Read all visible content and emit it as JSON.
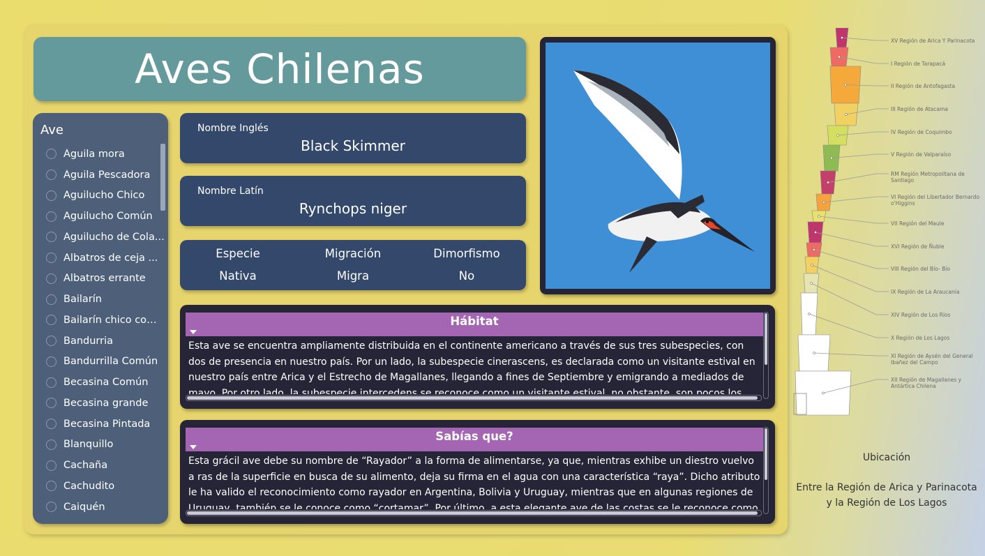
{
  "title": "Aves Chilenas",
  "sidebar": {
    "title": "Ave",
    "items": [
      {
        "label": "Águila mora"
      },
      {
        "label": "Águila Pescadora"
      },
      {
        "label": "Aguilucho Chico"
      },
      {
        "label": "Aguilucho Común"
      },
      {
        "label": "Aguilucho de Cola..."
      },
      {
        "label": "Albatros de ceja ..."
      },
      {
        "label": "Albatros errante"
      },
      {
        "label": "Bailarín"
      },
      {
        "label": "Bailarín chico com..."
      },
      {
        "label": "Bandurria"
      },
      {
        "label": "Bandurrilla Común"
      },
      {
        "label": "Becasina Común"
      },
      {
        "label": "Becasina grande"
      },
      {
        "label": "Becasina Pintada"
      },
      {
        "label": "Blanquillo"
      },
      {
        "label": "Cachaña"
      },
      {
        "label": "Cachudito"
      },
      {
        "label": "Caiquén"
      }
    ]
  },
  "english": {
    "label": "Nombre Inglés",
    "value": "Black Skimmer"
  },
  "latin": {
    "label": "Nombre Latín",
    "value": "Rynchops niger"
  },
  "attributes": [
    {
      "label": "Especie",
      "value": "Nativa"
    },
    {
      "label": "Migración",
      "value": "Migra"
    },
    {
      "label": "Dimorfismo",
      "value": "No"
    }
  ],
  "habitat": {
    "title": "Hábitat",
    "text": "Esta ave se encuentra ampliamente distribuida en el continente americano a través de sus tres subespecies, con dos de presencia en nuestro país. Por un lado, la subespecie cinerascens, es declarada como un visitante estival en nuestro país entre Arica y el Estrecho de Magallanes, llegando a fines de Septiembre y emigrando a mediados de mayo. Por otro lado, la subespecie intercedens se reconoce como un visitante estival, no obstante, son pocos los registros de su presencia en"
  },
  "sabias": {
    "title": "Sabías que?",
    "text": "Esta grácil ave debe su nombre de “Rayador” a la forma de alimentarse, ya que, mientras exhibe un diestro vuelvo a ras de la superficie en busca de su alimento, deja su firma en el agua con una característica “raya”. Dicho atributo le ha valido el reconocimiento como rayador en Argentina, Bolivia y Uruguay, mientras que en algunas regiones de Uruguay, también se le conoce como “cortamar”. Por último, a esta elegante ave de las costas se le reconoce como pico de tijeras,"
  },
  "map": {
    "regions": [
      {
        "label": "XV Región de Arica Y Parinacota",
        "color": "#c0356b"
      },
      {
        "label": "I Región de Tarapacá",
        "color": "#ee6a62"
      },
      {
        "label": "II Región de Antofagasta",
        "color": "#f6a93b"
      },
      {
        "label": "III Región de Atacama",
        "color": "#f2d163"
      },
      {
        "label": "IV Región de Coquimbo",
        "color": "#d5df5f"
      },
      {
        "label": "V Región de Valparaíso",
        "color": "#8fbc52"
      },
      {
        "label": "RM Región Metropolitana de Santiago",
        "color": "#c43f6a"
      },
      {
        "label": "VI Región del Libertador Bernardo o'Higgins",
        "color": "#f6a23d"
      },
      {
        "label": "VII Región del Maule",
        "color": "#e8e16a"
      },
      {
        "label": "XVI Región de Ñuble",
        "color": "#c0356b"
      },
      {
        "label": "VIII Región del Bío- Bío",
        "color": "#ee6a62"
      },
      {
        "label": "IX Región de La Araucanía",
        "color": "#f2d163"
      },
      {
        "label": "XIV Región de Los Ríos",
        "color": "#e6e4b0"
      },
      {
        "label": "X Región de Los Lagos",
        "color": "#ffffff"
      },
      {
        "label": "XI Región de Aysén del General Ibañez del Campo",
        "color": "#ffffff"
      },
      {
        "label": "XII Región de Magallanes y Antártica Chilena",
        "color": "#ffffff"
      }
    ]
  },
  "location": {
    "title": "Ubicación",
    "text": "Entre la Región de Arica y Parinacota y la Región de Los Lagos"
  }
}
